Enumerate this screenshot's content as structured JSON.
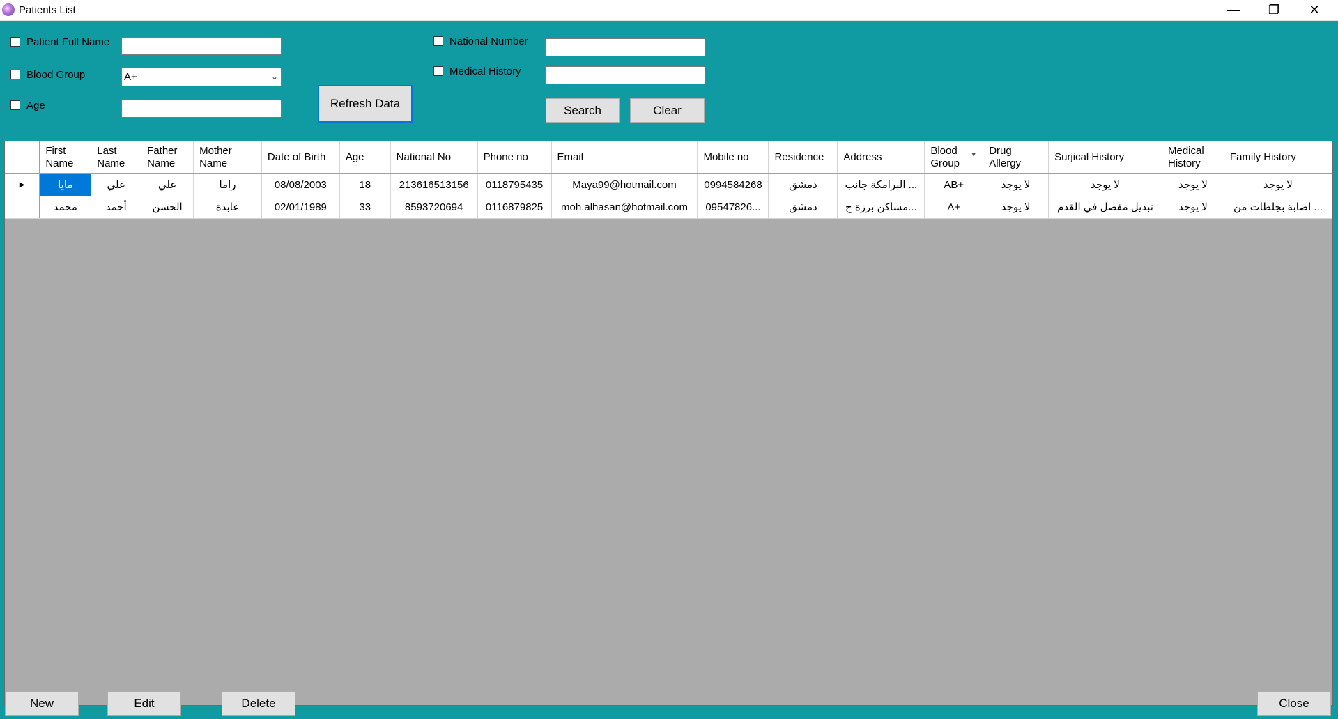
{
  "window": {
    "title": "Patients List",
    "controls": {
      "minimize": "—",
      "maximize": "❐",
      "close": "✕"
    }
  },
  "filters": {
    "patient_full_name": {
      "label": "Patient Full Name",
      "value": ""
    },
    "blood_group": {
      "label": "Blood Group",
      "value": "A+"
    },
    "age": {
      "label": "Age",
      "value": ""
    },
    "national_number": {
      "label": "National Number",
      "value": ""
    },
    "medical_history": {
      "label": "Medical History",
      "value": ""
    }
  },
  "buttons": {
    "refresh": "Refresh Data",
    "search": "Search",
    "clear": "Clear",
    "new": "New",
    "edit": "Edit",
    "delete": "Delete",
    "close": "Close"
  },
  "grid": {
    "columns": [
      "First Name",
      "Last Name",
      "Father Name",
      "Mother Name",
      "Date of Birth",
      "Age",
      "National No",
      "Phone no",
      "Email",
      "Mobile no",
      "Residence",
      "Address",
      "Blood Group",
      "Drug Allergy",
      "Surjical History",
      "Medical History",
      "Family History"
    ],
    "rows": [
      [
        "مايا",
        "علي",
        "علي",
        "راما",
        "08/08/2003",
        "18",
        "213616513156",
        "0118795435",
        "Maya99@hotmail.com",
        "0994584268",
        "دمشق",
        "البرامكة جانب ...",
        "AB+",
        "لا يوجد",
        "لا يوجد",
        "لا يوجد",
        "لا يوجد"
      ],
      [
        "محمد",
        "أحمد",
        "الحسن",
        "عابدة",
        "02/01/1989",
        "33",
        "8593720694",
        "0116879825",
        "moh.alhasan@hotmail.com",
        "09547826...",
        "دمشق",
        "مساكن برزة ج...",
        "A+",
        "لا يوجد",
        "تبديل مفصل في القدم",
        "لا يوجد",
        "اصابة بجلطات من ..."
      ]
    ]
  },
  "colors": {
    "window_bg": "#109aa1",
    "grid_bg": "#ababab",
    "selection": "#0078d7"
  }
}
